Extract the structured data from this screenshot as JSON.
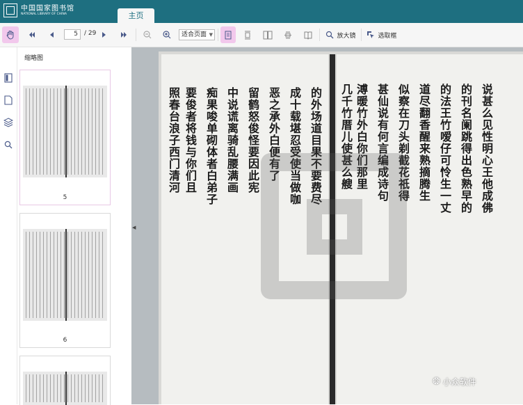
{
  "header": {
    "logo_cn": "中国国家图书馆",
    "logo_en": "NATIONAL LIBRARY OF CHINA",
    "tab_label": "主页"
  },
  "toolbar": {
    "current_page": "5",
    "total_pages": "/ 29",
    "zoom_option": "适合页面",
    "magnifier_label": "放大镜",
    "select_label": "选取框"
  },
  "sidebar": {
    "title": "缩略图",
    "thumbnails": [
      {
        "page": "5"
      },
      {
        "page": "6"
      },
      {
        "page": ""
      }
    ]
  },
  "document": {
    "right_page_columns": [
      "说甚么见性明心王他成佛",
      "的刊名阑跳得出色熟早的",
      "的法王竹嗳仔可怜生一丈",
      "道尽翻香醒来熟摘腾生",
      "似察在刀头剃截花祇得",
      "甚仙说有何言编成诗句",
      "溥暖竹外白你们那里",
      "几千竹厝儿使甚么艘"
    ],
    "left_page_columns": [
      "的外场道目果不要费尽",
      "成十载堪忍受使当做咖",
      "恶之承外白便有了",
      "留鹤怒俊怪要因此宪",
      "中说谎离骑乱腰满画",
      "痴果唆单砌体者白弟子",
      "要俊者将钱与你们且",
      "照春台浪子西门清河"
    ],
    "brand_text": "小众软件",
    "colors": {
      "header_bg": "#1e6f80",
      "active_tool": "#f2c8ec",
      "viewer_bg": "#b6bcc0"
    }
  }
}
